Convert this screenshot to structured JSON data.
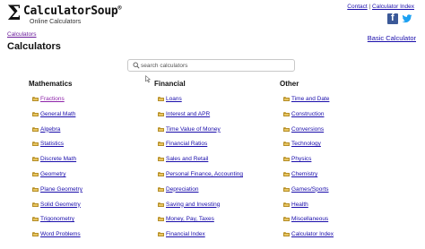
{
  "header": {
    "logo_symbol": "Σ",
    "logo_name": "CalculatorSoup",
    "logo_reg": "®",
    "logo_subtitle": "Online Calculators",
    "links": [
      "Contact",
      "Calculator Index"
    ],
    "link_separator": "|",
    "social_icons": [
      "facebook-icon",
      "twitter-icon"
    ],
    "facebook_letter": "f"
  },
  "breadcrumb": "Calculators",
  "page_title": "Calculators",
  "basic_link": "Basic Calculator",
  "search": {
    "placeholder": "search calculators",
    "value": ""
  },
  "columns": [
    {
      "heading": "Mathematics",
      "items": [
        "Fractions",
        "General Math",
        "Algebra",
        "Statistics",
        "Discrete Math",
        "Geometry",
        "Plane Geometry",
        "Solid Geometry",
        "Trigonometry",
        "Word Problems"
      ]
    },
    {
      "heading": "Financial",
      "items": [
        "Loans",
        "Interest and APR",
        "Time Value of Money",
        "Financial Ratios",
        "Sales and Retail",
        "Personal Finance, Accounting",
        "Depreciation",
        "Saving and Investing",
        "Money, Pay, Taxes",
        "Financial Index"
      ]
    },
    {
      "heading": "Other",
      "items": [
        "Time and Date",
        "Construction",
        "Conversions",
        "Technology",
        "Physics",
        "Chemistry",
        "Games/Sports",
        "Health",
        "Miscellaneous",
        "Calculator Index"
      ]
    }
  ],
  "colors": {
    "link": "#1a0dab",
    "visited": "#8e24aa",
    "folder": "#e8c661",
    "facebook": "#3b5998",
    "twitter": "#1da1f2"
  }
}
